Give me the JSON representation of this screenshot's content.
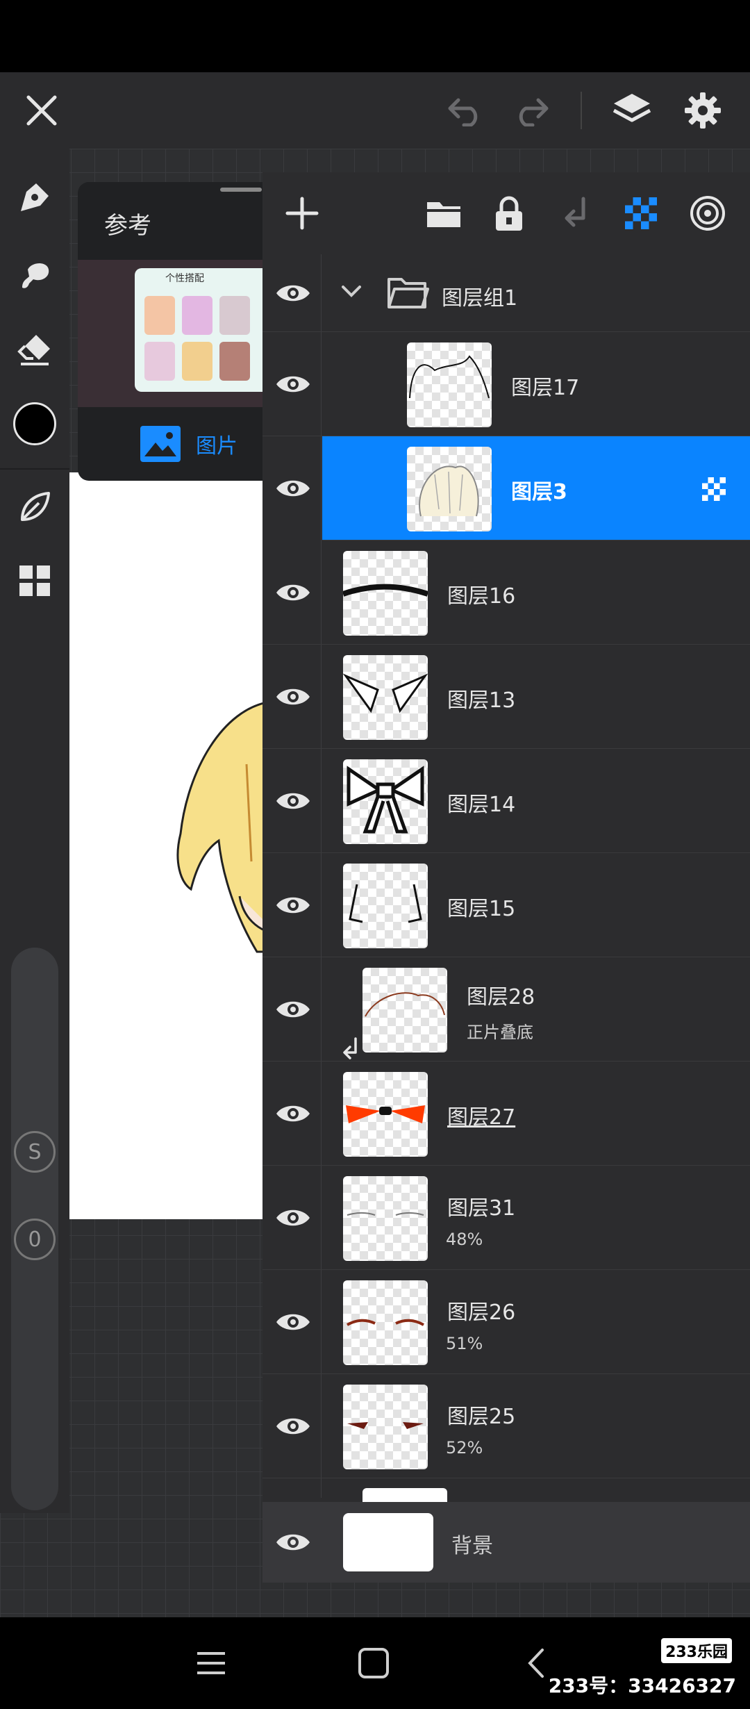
{
  "reference": {
    "title": "参考",
    "image_tab_label": "图片",
    "thumbnail_caption": "个性搭配"
  },
  "layers": {
    "group": {
      "name": "图层组1"
    },
    "items": [
      {
        "name": "图层17",
        "sub": ""
      },
      {
        "name": "图层3",
        "sub": ""
      },
      {
        "name": "图层16",
        "sub": ""
      },
      {
        "name": "图层13",
        "sub": ""
      },
      {
        "name": "图层14",
        "sub": ""
      },
      {
        "name": "图层15",
        "sub": ""
      },
      {
        "name": "图层28",
        "sub": "正片叠底"
      },
      {
        "name": "图层27",
        "sub": ""
      },
      {
        "name": "图层31",
        "sub": "48%"
      },
      {
        "name": "图层26",
        "sub": "51%"
      },
      {
        "name": "图层25",
        "sub": "52%"
      }
    ],
    "background": {
      "name": "背景"
    }
  },
  "sliders": {
    "brush_size_marker": "S",
    "opacity_marker": "0"
  },
  "watermark": {
    "logo": "233乐园",
    "id_text": "233号：33426327"
  },
  "colors": {
    "accent": "#1a8cff",
    "selected_row": "#0a84ff",
    "current_color": "#000000"
  }
}
